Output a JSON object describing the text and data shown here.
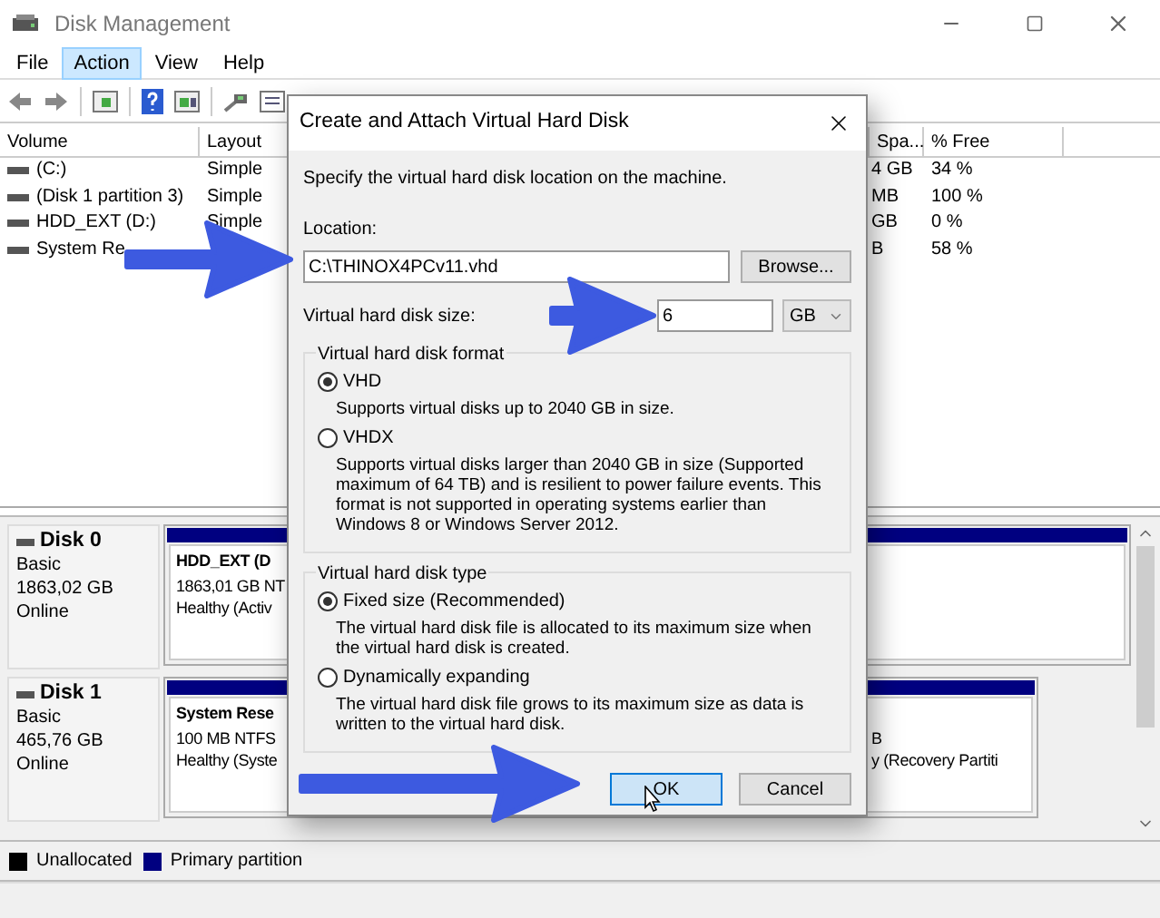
{
  "window": {
    "title": "Disk Management"
  },
  "menu": [
    {
      "label": "File",
      "selected": false
    },
    {
      "label": "Action",
      "selected": true
    },
    {
      "label": "View",
      "selected": false
    },
    {
      "label": "Help",
      "selected": false
    }
  ],
  "volume_list": {
    "columns": [
      "Volume",
      "Layout",
      "Spa...",
      "% Free"
    ],
    "rows": [
      {
        "volume": "(C:)",
        "layout": "Simple",
        "column_3": "4 GB",
        "free": "34 %"
      },
      {
        "volume": "(Disk 1 partition 3)",
        "layout": "Simple",
        "column_3": "MB",
        "free": "100 %"
      },
      {
        "volume": "HDD_EXT (D:)",
        "layout": "Simple",
        "column_3": "GB",
        "free": "0 %"
      },
      {
        "volume": "System Re",
        "column_3": "B",
        "free": "58 %"
      }
    ]
  },
  "disks": [
    {
      "name": "Disk 0",
      "type": "Basic",
      "size": "1863,02 GB",
      "status": "Online",
      "partitions": [
        {
          "title": "HDD_EXT (D",
          "lines": [
            "1863,01 GB NT",
            "Healthy (Activ"
          ]
        }
      ]
    },
    {
      "name": "Disk 1",
      "type": "Basic",
      "size": "465,76 GB",
      "status": "Online",
      "partitions": [
        {
          "title": "System Rese",
          "lines": [
            "100 MB NTFS",
            "Healthy (Syste"
          ]
        },
        {
          "lines": [
            "B",
            "y (Recovery Partiti"
          ]
        }
      ]
    }
  ],
  "legend": [
    {
      "label": "Unallocated",
      "color": "#000000"
    },
    {
      "label": "Primary partition",
      "color": "#000080"
    }
  ],
  "dialog": {
    "title": "Create and Attach Virtual Hard Disk",
    "description": "Specify the virtual hard disk location on the machine.",
    "location": {
      "label": "Location:",
      "value": "C:\\THINOX4PCv11.vhd"
    },
    "browse_button": "Browse...",
    "size": {
      "label": "Virtual hard disk size:",
      "value": "6",
      "unit": "GB"
    },
    "groups": [
      {
        "title": "Virtual hard disk format",
        "options": [
          {
            "label": "VHD",
            "selected": true,
            "description": "Supports virtual disks up to 2040 GB in size."
          },
          {
            "label": "VHDX",
            "selected": false,
            "description": "Supports virtual disks larger than 2040 GB in size (Supported maximum of 64 TB) and is resilient to power failure events. This format is not supported in operating systems earlier than Windows 8 or Windows Server 2012."
          }
        ]
      },
      {
        "title": "Virtual hard disk type",
        "options": [
          {
            "label": "Fixed size (Recommended)",
            "selected": true,
            "description": "The virtual hard disk file is allocated to its maximum size when the virtual hard disk is created."
          },
          {
            "label": "Dynamically expanding",
            "selected": false,
            "description": "The virtual hard disk file grows to its maximum size as data is written to the virtual hard disk."
          }
        ]
      }
    ],
    "buttons": [
      {
        "label": "OK",
        "focused": true
      },
      {
        "label": "Cancel",
        "focused": false
      }
    ]
  }
}
